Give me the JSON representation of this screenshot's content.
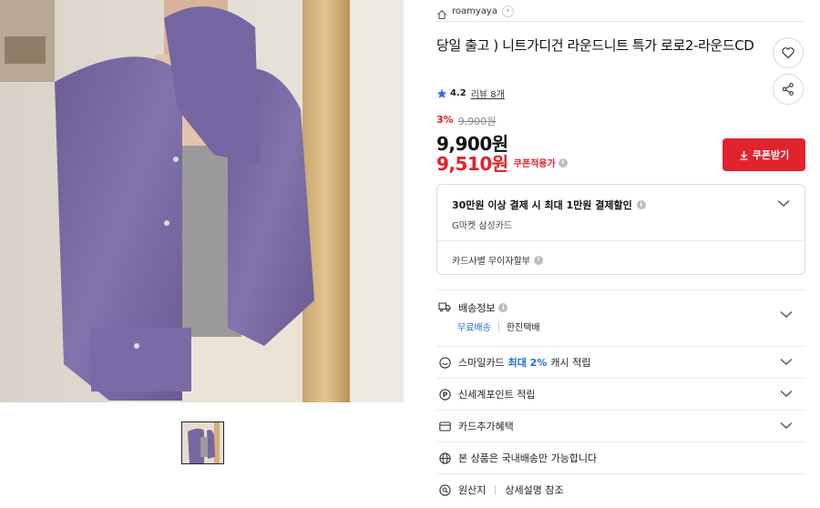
{
  "seller": {
    "name": "roamyaya",
    "home_icon": "home-icon",
    "arrow": "›"
  },
  "product": {
    "title": "당일 출고 ) 니트가디건 라운드니트 특가 로로2-라운드CD",
    "rating": "4.2",
    "reviews_label": "리뷰 8개",
    "discount_rate": "3%",
    "original_price": "9,900원",
    "price": "9,900원",
    "coupon_price": "9,510원",
    "coupon_applied_label": "쿠폰적용가"
  },
  "buttons": {
    "coupon_label": "쿠폰받기"
  },
  "card_promo": {
    "title": "30만원 이상 결제 시 최대 1만원 결제할인",
    "subtitle": "G마켓 삼성카드",
    "installment": "카드사별 무이자할부"
  },
  "shipping": {
    "label": "배송정보",
    "free": "무료배송",
    "carrier": "한진택배"
  },
  "benefits": {
    "smile_prefix": "스마일카드",
    "smile_highlight": "최대 2%",
    "smile_suffix": "캐시 적립",
    "shinsegae": "신세계포인트 적립",
    "card_extra": "카드추가혜택",
    "domestic": "본 상품은 국내배송만 가능합니다",
    "origin_label": "원산지",
    "origin_value": "상세설명 참조"
  },
  "colors": {
    "accent_red": "#e1232e",
    "price_red": "#e4202a",
    "link_blue": "#1c6fd8",
    "cardigan_purple": "#7b6aa3"
  }
}
